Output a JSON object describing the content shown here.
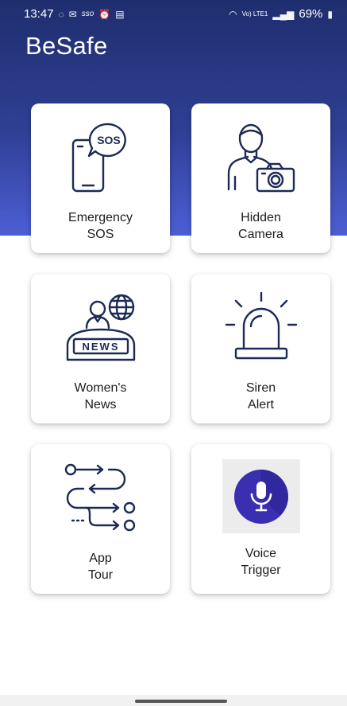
{
  "status_bar": {
    "time": "13:47",
    "left_icons": [
      "whatsapp-icon",
      "gmail-icon",
      "sso-icon",
      "alarm-icon",
      "calendar-icon"
    ],
    "network": "Vo) LTE1",
    "battery": "69%"
  },
  "app": {
    "title": "BeSafe"
  },
  "cards": [
    {
      "line1": "Emergency",
      "line2": "SOS",
      "icon": "phone-sos-icon"
    },
    {
      "line1": "Hidden",
      "line2": "Camera",
      "icon": "person-camera-icon"
    },
    {
      "line1": "Women's",
      "line2": "News",
      "icon": "news-anchor-icon"
    },
    {
      "line1": "Siren",
      "line2": "Alert",
      "icon": "siren-icon"
    },
    {
      "line1": "App",
      "line2": "Tour",
      "icon": "tour-flow-icon"
    },
    {
      "line1": "Voice",
      "line2": "Trigger",
      "icon": "microphone-icon"
    }
  ],
  "colors": {
    "header_top": "#1f2e6e",
    "header_bottom": "#4c5ed4",
    "icon_stroke": "#1c2a55",
    "mic_circle": "#3a2fb0"
  }
}
